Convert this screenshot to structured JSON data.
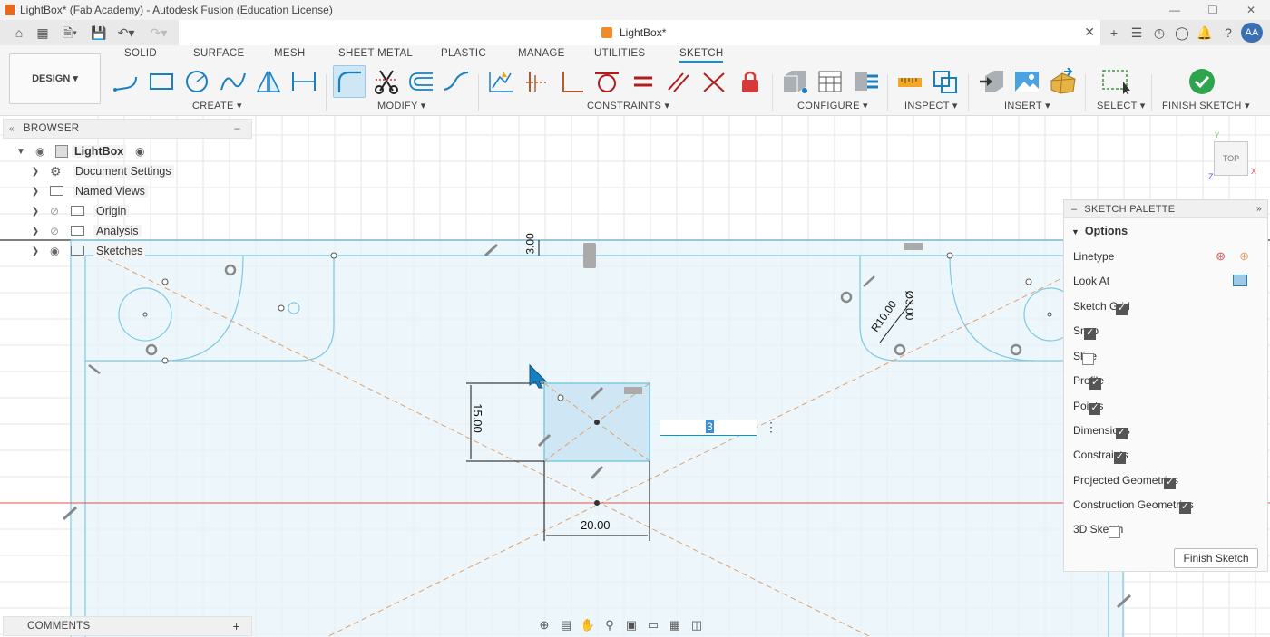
{
  "window": {
    "title": "LightBox* (Fab Academy) - Autodesk Fusion (Education License)",
    "controls": [
      "minimize-icon",
      "restore-icon",
      "close-icon"
    ]
  },
  "tabbar": {
    "doc_tab_label": "LightBox*",
    "user_initials": "AA"
  },
  "toolbar": {
    "design_label": "DESIGN",
    "workspace_tabs": [
      "SOLID",
      "SURFACE",
      "MESH",
      "SHEET METAL",
      "PLASTIC",
      "MANAGE",
      "UTILITIES",
      "SKETCH"
    ],
    "active_tab": "SKETCH",
    "groups": {
      "create": "CREATE",
      "modify": "MODIFY",
      "constraints": "CONSTRAINTS",
      "configure": "CONFIGURE",
      "inspect": "INSPECT",
      "insert": "INSERT",
      "select": "SELECT",
      "finish": "FINISH SKETCH"
    }
  },
  "browser": {
    "title": "BROWSER",
    "root": "LightBox",
    "items": [
      {
        "label": "Document Settings",
        "icon": "gear-icon"
      },
      {
        "label": "Named Views",
        "icon": "folder-icon"
      },
      {
        "label": "Origin",
        "icon": "folder-icon"
      },
      {
        "label": "Analysis",
        "icon": "folder-icon"
      },
      {
        "label": "Sketches",
        "icon": "folder-icon"
      }
    ]
  },
  "canvas": {
    "dims": {
      "top_gap": "3.00",
      "height": "15.00",
      "width": "20.00",
      "radius": "R10.00",
      "diameter": "Ø3.00"
    },
    "input_value": "3"
  },
  "palette": {
    "title": "SKETCH PALETTE",
    "section": "Options",
    "rows": [
      {
        "label": "Linetype",
        "type": "icon"
      },
      {
        "label": "Look At",
        "type": "icon"
      },
      {
        "label": "Sketch Grid",
        "checked": true
      },
      {
        "label": "Snap",
        "checked": true
      },
      {
        "label": "Slice",
        "checked": false
      },
      {
        "label": "Profile",
        "checked": true
      },
      {
        "label": "Points",
        "checked": true
      },
      {
        "label": "Dimensions",
        "checked": true
      },
      {
        "label": "Constraints",
        "checked": true
      },
      {
        "label": "Projected Geometries",
        "checked": true
      },
      {
        "label": "Construction Geometries",
        "checked": true
      },
      {
        "label": "3D Sketch",
        "checked": false
      }
    ],
    "finish_label": "Finish Sketch"
  },
  "viewcube": {
    "face": "TOP",
    "axes": [
      "Y",
      "X",
      "Z"
    ]
  },
  "comments": {
    "title": "COMMENTS"
  },
  "colors": {
    "accent": "#0696d7",
    "sketch_line": "#7ec8e3",
    "construction": "#e0a070",
    "x_axis": "#e05050",
    "profile_fill": "#e8f4fb",
    "grid": "#e6e6e6"
  }
}
